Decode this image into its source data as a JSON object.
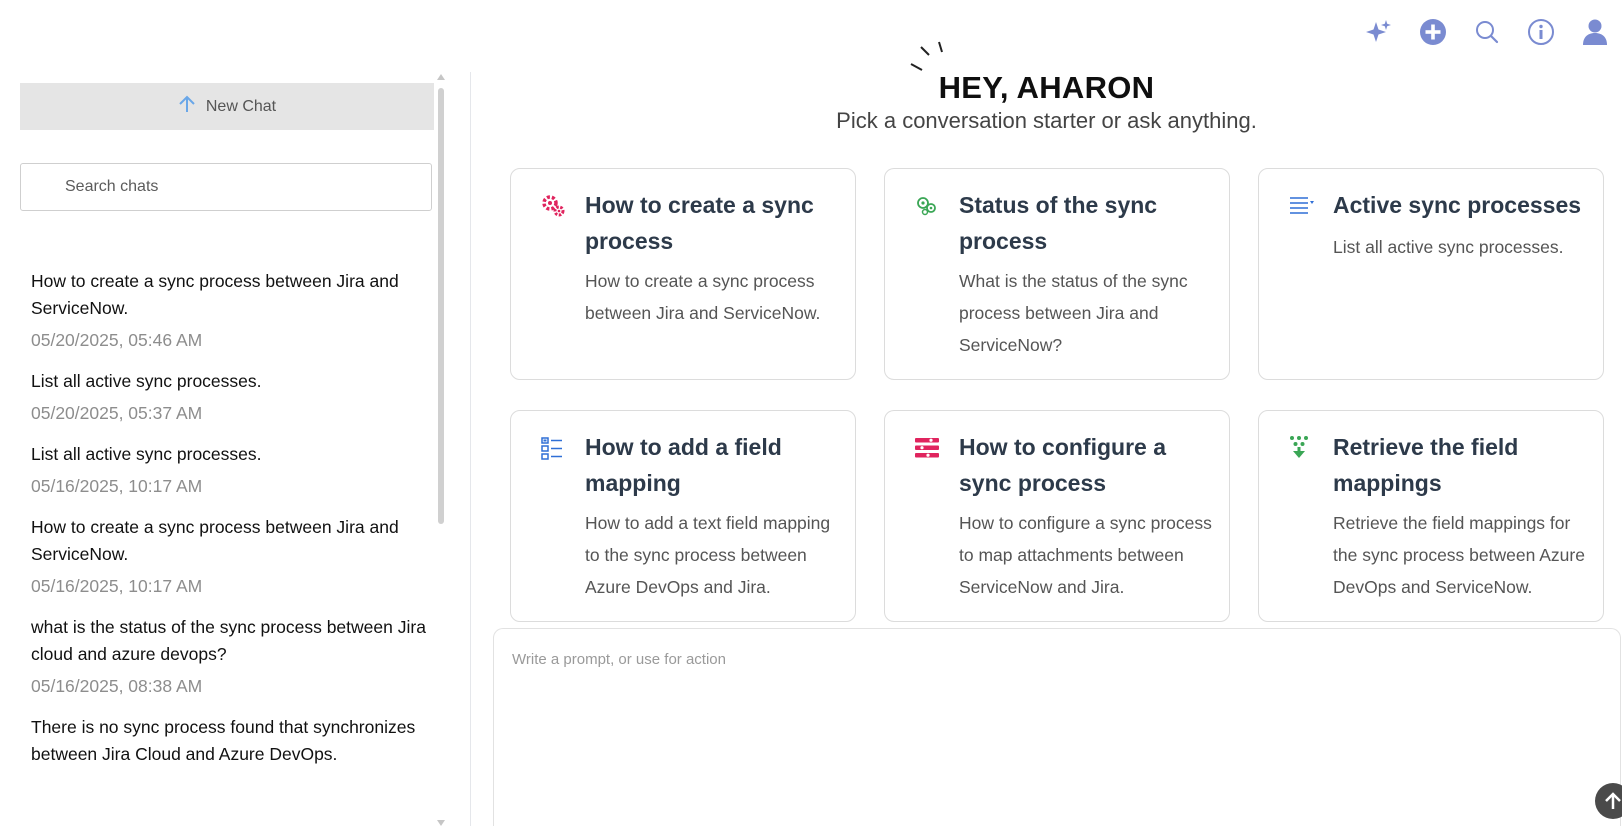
{
  "topbar": {
    "icons": [
      "sparkles-icon",
      "plus-circle-icon",
      "search-icon",
      "info-icon",
      "user-icon"
    ],
    "accent": "#7a8bd1"
  },
  "sidebar": {
    "new_chat_label": "New Chat",
    "search_placeholder": "Search chats",
    "history": [
      {
        "title": "How to create a sync process between Jira and ServiceNow.",
        "date": "05/20/2025, 05:46 AM"
      },
      {
        "title": "List all active sync processes.",
        "date": "05/20/2025, 05:37 AM"
      },
      {
        "title": "List all active sync processes.",
        "date": "05/16/2025, 10:17 AM"
      },
      {
        "title": "How to create a sync process between Jira and ServiceNow.",
        "date": "05/16/2025, 10:17 AM"
      },
      {
        "title": "what is the status of the sync process between Jira cloud and azure devops?",
        "date": "05/16/2025, 08:38 AM"
      },
      {
        "title": "There is no sync process found that synchronizes between Jira Cloud and Azure DevOps.",
        "date": ""
      }
    ]
  },
  "greeting": {
    "title": "HEY, AHARON",
    "subtitle": "Pick a conversation starter or ask anything."
  },
  "cards": [
    {
      "icon": "gears-icon",
      "color": "#e0245e",
      "title": "How to create a sync process",
      "desc": "How to create a sync process between Jira and ServiceNow."
    },
    {
      "icon": "status-gears-icon",
      "color": "#3aa655",
      "title": "Status of the sync process",
      "desc": "What is the status of the sync process between Jira and ServiceNow?"
    },
    {
      "icon": "list-icon",
      "color": "#2f6fd6",
      "title": "Active sync processes",
      "desc": "List all active sync processes."
    },
    {
      "icon": "checklist-icon",
      "color": "#2f6fd6",
      "title": "How to add a field mapping",
      "desc": "How to add a text field mapping to the sync process between Azure DevOps and Jira."
    },
    {
      "icon": "sliders-icon",
      "color": "#e0245e",
      "title": "How to configure a sync process",
      "desc": "How to configure a sync process to map attachments between ServiceNow and Jira."
    },
    {
      "icon": "download-dots-icon",
      "color": "#3aa655",
      "title": "Retrieve the field mappings",
      "desc": "Retrieve the field mappings for the sync process between Azure DevOps and ServiceNow."
    }
  ],
  "prompt": {
    "placeholder": "Write a prompt, or use for action"
  }
}
